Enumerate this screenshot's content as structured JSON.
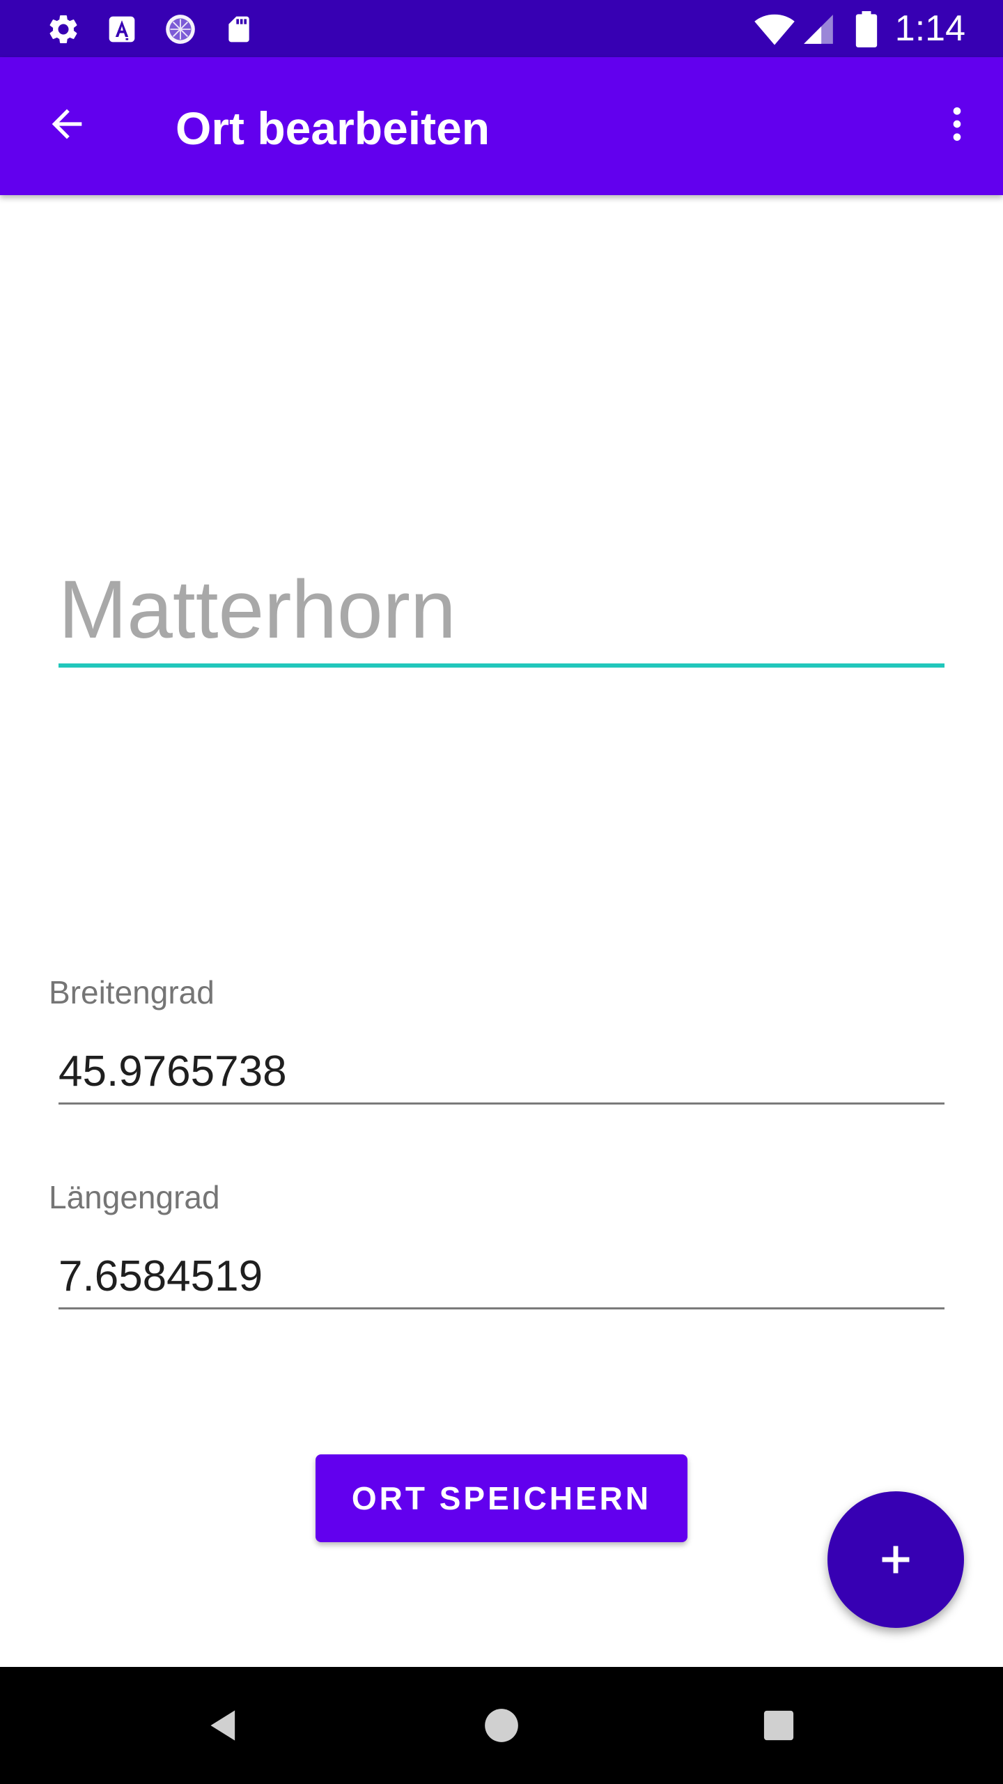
{
  "colors": {
    "status_bar": "#3700b3",
    "app_bar": "#6200ee",
    "accent": "#21c7bb",
    "fab": "#3700b3",
    "nav_bar": "#000000"
  },
  "status_bar": {
    "time": "1:14",
    "left_icons": [
      "settings-icon",
      "accessibility-a-icon",
      "sync-circle-icon",
      "sd-card-icon"
    ],
    "right_icons": [
      "wifi-icon",
      "cell-signal-icon",
      "battery-icon"
    ]
  },
  "app_bar": {
    "title": "Ort bearbeiten",
    "back_icon": "arrow-back-icon",
    "menu_icon": "more-vert-icon"
  },
  "form": {
    "name_placeholder": "Matterhorn",
    "name_value": "",
    "latitude": {
      "label": "Breitengrad",
      "value": "45.9765738"
    },
    "longitude": {
      "label": "Längengrad",
      "value": "7.6584519"
    },
    "save_label": "ORT SPEICHERN"
  },
  "fab": {
    "icon": "add-icon"
  },
  "nav_bar": {
    "icons": [
      "nav-back-icon",
      "nav-home-icon",
      "nav-recents-icon"
    ]
  }
}
